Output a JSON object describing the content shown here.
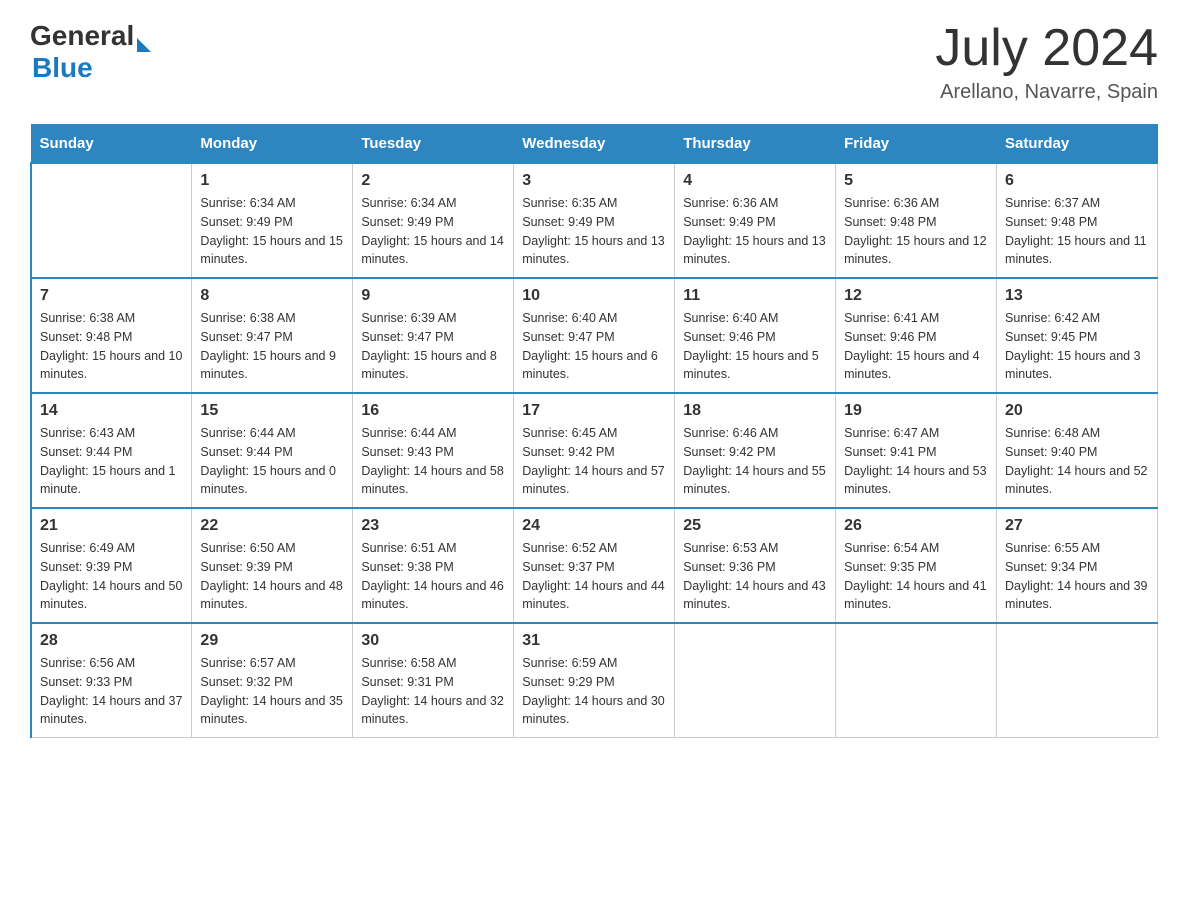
{
  "logo": {
    "general": "General",
    "triangle": "",
    "blue": "Blue"
  },
  "title": {
    "month_year": "July 2024",
    "location": "Arellano, Navarre, Spain"
  },
  "headers": [
    "Sunday",
    "Monday",
    "Tuesday",
    "Wednesday",
    "Thursday",
    "Friday",
    "Saturday"
  ],
  "weeks": [
    [
      {
        "day": "",
        "sunrise": "",
        "sunset": "",
        "daylight": ""
      },
      {
        "day": "1",
        "sunrise": "Sunrise: 6:34 AM",
        "sunset": "Sunset: 9:49 PM",
        "daylight": "Daylight: 15 hours and 15 minutes."
      },
      {
        "day": "2",
        "sunrise": "Sunrise: 6:34 AM",
        "sunset": "Sunset: 9:49 PM",
        "daylight": "Daylight: 15 hours and 14 minutes."
      },
      {
        "day": "3",
        "sunrise": "Sunrise: 6:35 AM",
        "sunset": "Sunset: 9:49 PM",
        "daylight": "Daylight: 15 hours and 13 minutes."
      },
      {
        "day": "4",
        "sunrise": "Sunrise: 6:36 AM",
        "sunset": "Sunset: 9:49 PM",
        "daylight": "Daylight: 15 hours and 13 minutes."
      },
      {
        "day": "5",
        "sunrise": "Sunrise: 6:36 AM",
        "sunset": "Sunset: 9:48 PM",
        "daylight": "Daylight: 15 hours and 12 minutes."
      },
      {
        "day": "6",
        "sunrise": "Sunrise: 6:37 AM",
        "sunset": "Sunset: 9:48 PM",
        "daylight": "Daylight: 15 hours and 11 minutes."
      }
    ],
    [
      {
        "day": "7",
        "sunrise": "Sunrise: 6:38 AM",
        "sunset": "Sunset: 9:48 PM",
        "daylight": "Daylight: 15 hours and 10 minutes."
      },
      {
        "day": "8",
        "sunrise": "Sunrise: 6:38 AM",
        "sunset": "Sunset: 9:47 PM",
        "daylight": "Daylight: 15 hours and 9 minutes."
      },
      {
        "day": "9",
        "sunrise": "Sunrise: 6:39 AM",
        "sunset": "Sunset: 9:47 PM",
        "daylight": "Daylight: 15 hours and 8 minutes."
      },
      {
        "day": "10",
        "sunrise": "Sunrise: 6:40 AM",
        "sunset": "Sunset: 9:47 PM",
        "daylight": "Daylight: 15 hours and 6 minutes."
      },
      {
        "day": "11",
        "sunrise": "Sunrise: 6:40 AM",
        "sunset": "Sunset: 9:46 PM",
        "daylight": "Daylight: 15 hours and 5 minutes."
      },
      {
        "day": "12",
        "sunrise": "Sunrise: 6:41 AM",
        "sunset": "Sunset: 9:46 PM",
        "daylight": "Daylight: 15 hours and 4 minutes."
      },
      {
        "day": "13",
        "sunrise": "Sunrise: 6:42 AM",
        "sunset": "Sunset: 9:45 PM",
        "daylight": "Daylight: 15 hours and 3 minutes."
      }
    ],
    [
      {
        "day": "14",
        "sunrise": "Sunrise: 6:43 AM",
        "sunset": "Sunset: 9:44 PM",
        "daylight": "Daylight: 15 hours and 1 minute."
      },
      {
        "day": "15",
        "sunrise": "Sunrise: 6:44 AM",
        "sunset": "Sunset: 9:44 PM",
        "daylight": "Daylight: 15 hours and 0 minutes."
      },
      {
        "day": "16",
        "sunrise": "Sunrise: 6:44 AM",
        "sunset": "Sunset: 9:43 PM",
        "daylight": "Daylight: 14 hours and 58 minutes."
      },
      {
        "day": "17",
        "sunrise": "Sunrise: 6:45 AM",
        "sunset": "Sunset: 9:42 PM",
        "daylight": "Daylight: 14 hours and 57 minutes."
      },
      {
        "day": "18",
        "sunrise": "Sunrise: 6:46 AM",
        "sunset": "Sunset: 9:42 PM",
        "daylight": "Daylight: 14 hours and 55 minutes."
      },
      {
        "day": "19",
        "sunrise": "Sunrise: 6:47 AM",
        "sunset": "Sunset: 9:41 PM",
        "daylight": "Daylight: 14 hours and 53 minutes."
      },
      {
        "day": "20",
        "sunrise": "Sunrise: 6:48 AM",
        "sunset": "Sunset: 9:40 PM",
        "daylight": "Daylight: 14 hours and 52 minutes."
      }
    ],
    [
      {
        "day": "21",
        "sunrise": "Sunrise: 6:49 AM",
        "sunset": "Sunset: 9:39 PM",
        "daylight": "Daylight: 14 hours and 50 minutes."
      },
      {
        "day": "22",
        "sunrise": "Sunrise: 6:50 AM",
        "sunset": "Sunset: 9:39 PM",
        "daylight": "Daylight: 14 hours and 48 minutes."
      },
      {
        "day": "23",
        "sunrise": "Sunrise: 6:51 AM",
        "sunset": "Sunset: 9:38 PM",
        "daylight": "Daylight: 14 hours and 46 minutes."
      },
      {
        "day": "24",
        "sunrise": "Sunrise: 6:52 AM",
        "sunset": "Sunset: 9:37 PM",
        "daylight": "Daylight: 14 hours and 44 minutes."
      },
      {
        "day": "25",
        "sunrise": "Sunrise: 6:53 AM",
        "sunset": "Sunset: 9:36 PM",
        "daylight": "Daylight: 14 hours and 43 minutes."
      },
      {
        "day": "26",
        "sunrise": "Sunrise: 6:54 AM",
        "sunset": "Sunset: 9:35 PM",
        "daylight": "Daylight: 14 hours and 41 minutes."
      },
      {
        "day": "27",
        "sunrise": "Sunrise: 6:55 AM",
        "sunset": "Sunset: 9:34 PM",
        "daylight": "Daylight: 14 hours and 39 minutes."
      }
    ],
    [
      {
        "day": "28",
        "sunrise": "Sunrise: 6:56 AM",
        "sunset": "Sunset: 9:33 PM",
        "daylight": "Daylight: 14 hours and 37 minutes."
      },
      {
        "day": "29",
        "sunrise": "Sunrise: 6:57 AM",
        "sunset": "Sunset: 9:32 PM",
        "daylight": "Daylight: 14 hours and 35 minutes."
      },
      {
        "day": "30",
        "sunrise": "Sunrise: 6:58 AM",
        "sunset": "Sunset: 9:31 PM",
        "daylight": "Daylight: 14 hours and 32 minutes."
      },
      {
        "day": "31",
        "sunrise": "Sunrise: 6:59 AM",
        "sunset": "Sunset: 9:29 PM",
        "daylight": "Daylight: 14 hours and 30 minutes."
      },
      {
        "day": "",
        "sunrise": "",
        "sunset": "",
        "daylight": ""
      },
      {
        "day": "",
        "sunrise": "",
        "sunset": "",
        "daylight": ""
      },
      {
        "day": "",
        "sunrise": "",
        "sunset": "",
        "daylight": ""
      }
    ]
  ]
}
